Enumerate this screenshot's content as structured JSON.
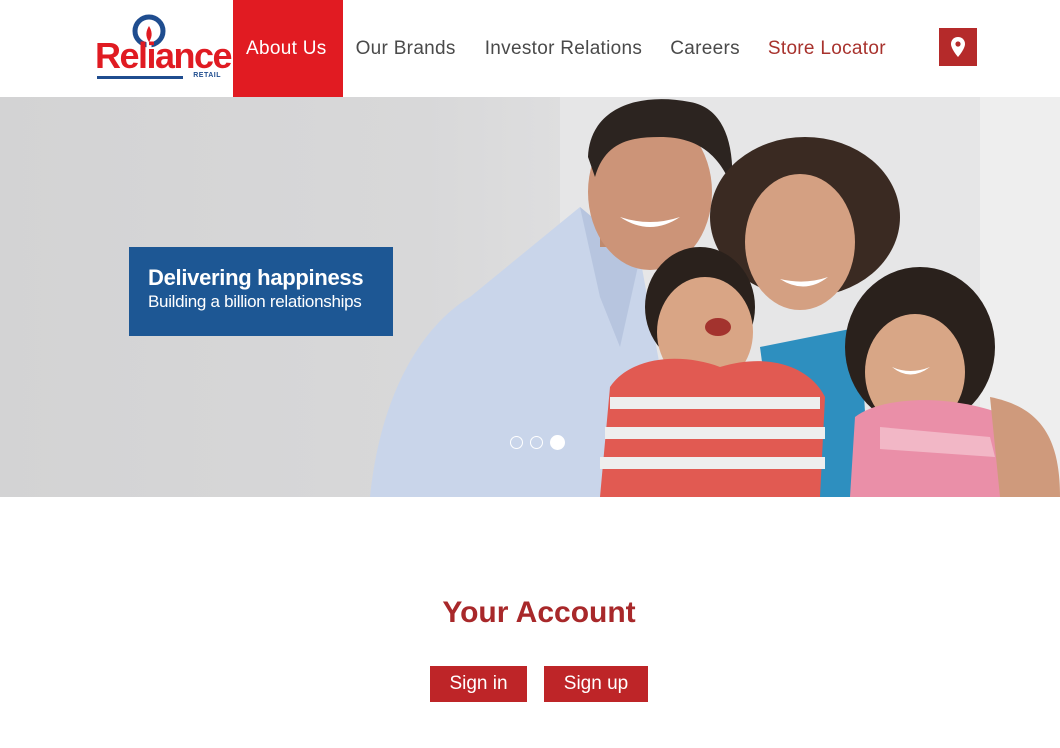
{
  "brand": {
    "name": "Reliance",
    "sub": "RETAIL"
  },
  "nav": {
    "items": [
      {
        "label": "About Us",
        "active": true
      },
      {
        "label": "Our Brands"
      },
      {
        "label": "Investor Relations"
      },
      {
        "label": "Careers"
      },
      {
        "label": "Store Locator"
      }
    ],
    "location_icon": "map-pin-icon"
  },
  "hero": {
    "title": "Delivering happiness",
    "subtitle": "Building a billion relationships",
    "slides_count": 3,
    "active_slide": 3
  },
  "account": {
    "title": "Your Account",
    "signin_label": "Sign in",
    "signup_label": "Sign up"
  },
  "colors": {
    "brand_red": "#e11b22",
    "button_red": "#be2528",
    "caption_blue": "#1d5794",
    "title_red": "#a8282a"
  }
}
